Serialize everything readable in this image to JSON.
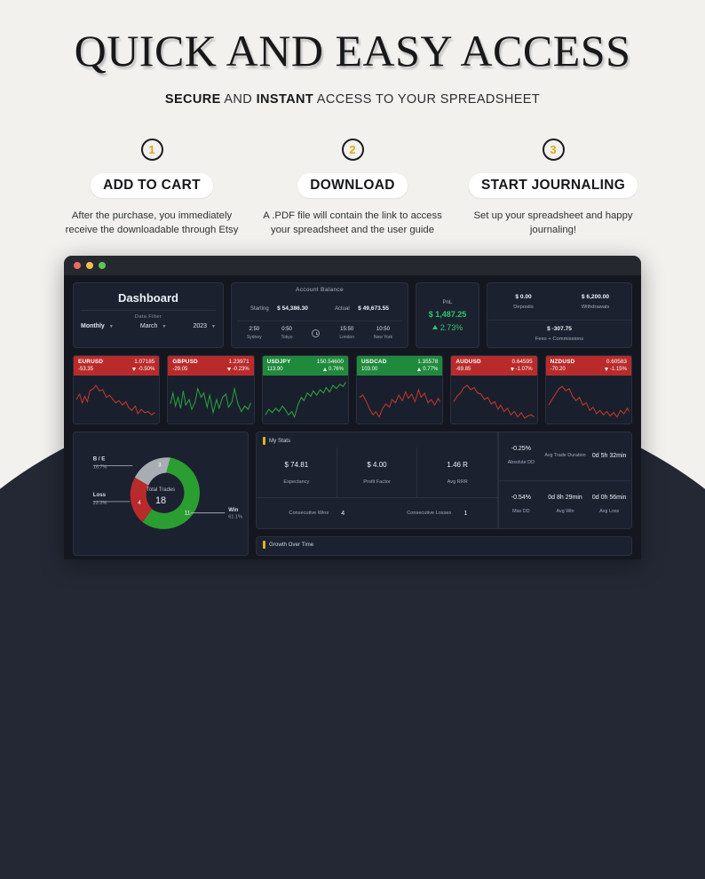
{
  "hero": {
    "title": "QUICK AND EASY ACCESS",
    "subtitle_parts": {
      "b1": "SECURE",
      "mid": " AND ",
      "b2": "INSTANT",
      "tail": " ACCESS TO YOUR SPREADSHEET"
    },
    "steps": [
      {
        "num": "1",
        "label": "ADD TO CART",
        "desc": "After the purchase, you immediately receive the downloadable through Etsy"
      },
      {
        "num": "2",
        "label": "DOWNLOAD",
        "desc": "A .PDF file will contain the link to access your spreadsheet and the user guide"
      },
      {
        "num": "3",
        "label": "START JOURNALING",
        "desc": "Set up your spreadsheet and happy journaling!"
      }
    ],
    "accent_color": "#d8ab16"
  },
  "window": {
    "traffic_lights": [
      "close-red",
      "minimize-yellow",
      "maximize-green"
    ]
  },
  "dashboard": {
    "title": "Dashboard",
    "filter_label": "Data Filter",
    "filters": [
      {
        "name": "period",
        "value": "Monthly"
      },
      {
        "name": "month",
        "value": "March"
      },
      {
        "name": "year",
        "value": "2023"
      }
    ],
    "account_balance": {
      "heading": "Account Balance",
      "starting_label": "Starting",
      "starting_value": "$ 54,386.30",
      "actual_label": "Actual",
      "actual_value": "$ 49,673.55",
      "sessions": [
        {
          "time": "2:50",
          "city": "Sydney"
        },
        {
          "time": "0:50",
          "city": "Tokyo"
        },
        {
          "time": "15:50",
          "city": "London"
        },
        {
          "time": "10:50",
          "city": "New York"
        }
      ]
    },
    "pnl": {
      "label": "PnL",
      "value": "$ 1,487.25",
      "percent": "2.73%",
      "color": "#2fc76a"
    },
    "flows": {
      "deposits_value": "$ 0.00",
      "deposits_label": "Deposits",
      "withdrawals_value": "$ 6,200.00",
      "withdrawals_label": "Withdrawals",
      "fees_value": "$ -307.75",
      "fees_label": "Fees + Commissions"
    },
    "pairs": [
      {
        "symbol": "EURUSD",
        "price": "1.07185",
        "change": "-53.35",
        "percent": "-0.50%",
        "dir": "down"
      },
      {
        "symbol": "GBPUSD",
        "price": "1.23971",
        "change": "-29.05",
        "percent": "-0.23%",
        "dir": "down"
      },
      {
        "symbol": "USDJPY",
        "price": "150.54600",
        "change": "113.90",
        "percent": "0.76%",
        "dir": "up"
      },
      {
        "symbol": "USDCAD",
        "price": "1.35578",
        "change": "103.00",
        "percent": "0.77%",
        "dir": "up"
      },
      {
        "symbol": "AUDUSD",
        "price": "0.64595",
        "change": "-69.85",
        "percent": "-1.07%",
        "dir": "down"
      },
      {
        "symbol": "NZDUSD",
        "price": "0.60583",
        "change": "-70.20",
        "percent": "-1.15%",
        "dir": "down"
      }
    ],
    "my_stats": {
      "heading": "My Stats",
      "cells": [
        {
          "value": "$ 74.81",
          "label": "Expectancy"
        },
        {
          "value": "$ 4.00",
          "label": "Profit Factor"
        },
        {
          "value": "1.46 R",
          "label": "Avg RRR"
        }
      ],
      "consecutive": [
        {
          "label": "Consecutive Wins",
          "value": "4"
        },
        {
          "label": "Consecutive Losses",
          "value": "1"
        }
      ]
    },
    "drawdown": [
      [
        {
          "value": "-0.25%",
          "label": "Absolute DD"
        },
        {
          "value": "",
          "label": "Avg Trade Duration"
        },
        {
          "value": "0d 5h 32min",
          "label": ""
        }
      ],
      [
        {
          "value": "-0.54%",
          "label": "Max DD"
        },
        {
          "value": "0d 8h 29min",
          "label": "Avg Win"
        },
        {
          "value": "0d 0h 56min",
          "label": "Avg Loss"
        }
      ]
    ],
    "growth": {
      "heading": "Growth Over Time"
    }
  },
  "chart_data": {
    "type": "pie",
    "title": "Total Trades",
    "center_value": "18",
    "categories": [
      "Win",
      "Loss",
      "B/E"
    ],
    "values": [
      11,
      4,
      3
    ],
    "percents": [
      "61.1%",
      "22.2%",
      "16.7%"
    ],
    "colors": [
      "#2b9e32",
      "#b92b2b",
      "#a8adb3"
    ],
    "labels": [
      {
        "name": "B/E",
        "percent": "16.7%",
        "count": "3",
        "color": "#a8adb3"
      },
      {
        "name": "Loss",
        "percent": "22.2%",
        "count": "4",
        "color": "#b92b2b"
      },
      {
        "name": "Win",
        "percent": "61.1%",
        "count": "11",
        "color": "#2b9e32"
      }
    ],
    "legend_position": "callouts",
    "grid": false
  }
}
